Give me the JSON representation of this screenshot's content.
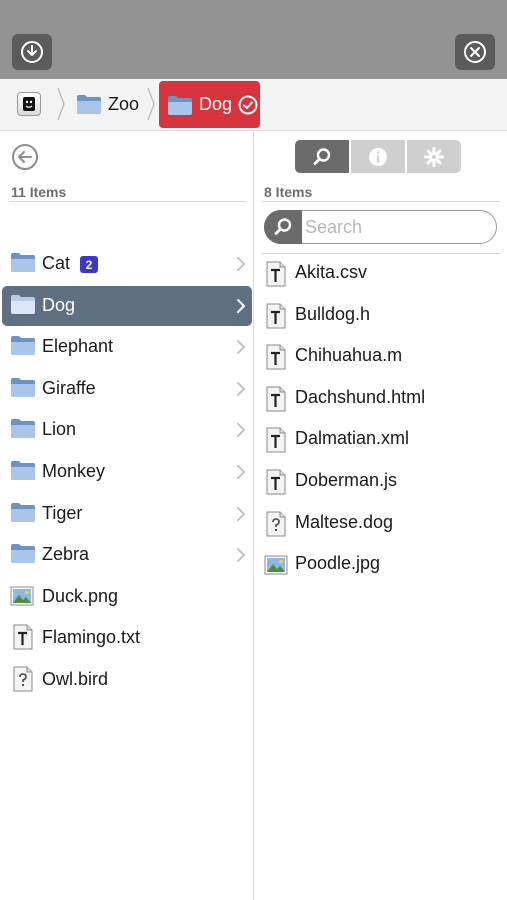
{
  "window": {
    "download_icon": "download-icon",
    "close_icon": "close-circle-icon"
  },
  "breadcrumb": {
    "home_icon": "app-home-icon",
    "items": [
      {
        "label": "Zoo",
        "icon": "folder-icon"
      },
      {
        "label": "Dog",
        "icon": "folder-icon",
        "active": true,
        "status_icon": "checkmark-circle-icon"
      }
    ]
  },
  "left_pane": {
    "back_icon": "back-arrow-circle-icon",
    "count_label": "11 Items",
    "items": [
      {
        "label": "Cat",
        "type": "folder",
        "badge": "2"
      },
      {
        "label": "Dog",
        "type": "folder",
        "selected": true
      },
      {
        "label": "Elephant",
        "type": "folder"
      },
      {
        "label": "Giraffe",
        "type": "folder"
      },
      {
        "label": "Lion",
        "type": "folder"
      },
      {
        "label": "Monkey",
        "type": "folder"
      },
      {
        "label": "Tiger",
        "type": "folder"
      },
      {
        "label": "Zebra",
        "type": "folder"
      },
      {
        "label": "Duck.png",
        "type": "image"
      },
      {
        "label": "Flamingo.txt",
        "type": "text"
      },
      {
        "label": "Owl.bird",
        "type": "unknown"
      }
    ]
  },
  "right_pane": {
    "tabs": [
      {
        "icon": "search-icon",
        "selected": true
      },
      {
        "icon": "info-icon"
      },
      {
        "icon": "gear-icon"
      }
    ],
    "count_label": "8 Items",
    "search": {
      "placeholder": "Search",
      "value": ""
    },
    "files": [
      {
        "label": "Akita.csv",
        "type": "text"
      },
      {
        "label": "Bulldog.h",
        "type": "text"
      },
      {
        "label": "Chihuahua.m",
        "type": "text"
      },
      {
        "label": "Dachshund.html",
        "type": "text"
      },
      {
        "label": "Dalmatian.xml",
        "type": "text"
      },
      {
        "label": "Doberman.js",
        "type": "text"
      },
      {
        "label": "Maltese.dog",
        "type": "unknown"
      },
      {
        "label": "Poodle.jpg",
        "type": "image"
      }
    ]
  },
  "colors": {
    "topbar": "#939393",
    "active_crumb": "#d8343d",
    "selected_row": "#5f7082",
    "badge": "#3a37c9"
  }
}
